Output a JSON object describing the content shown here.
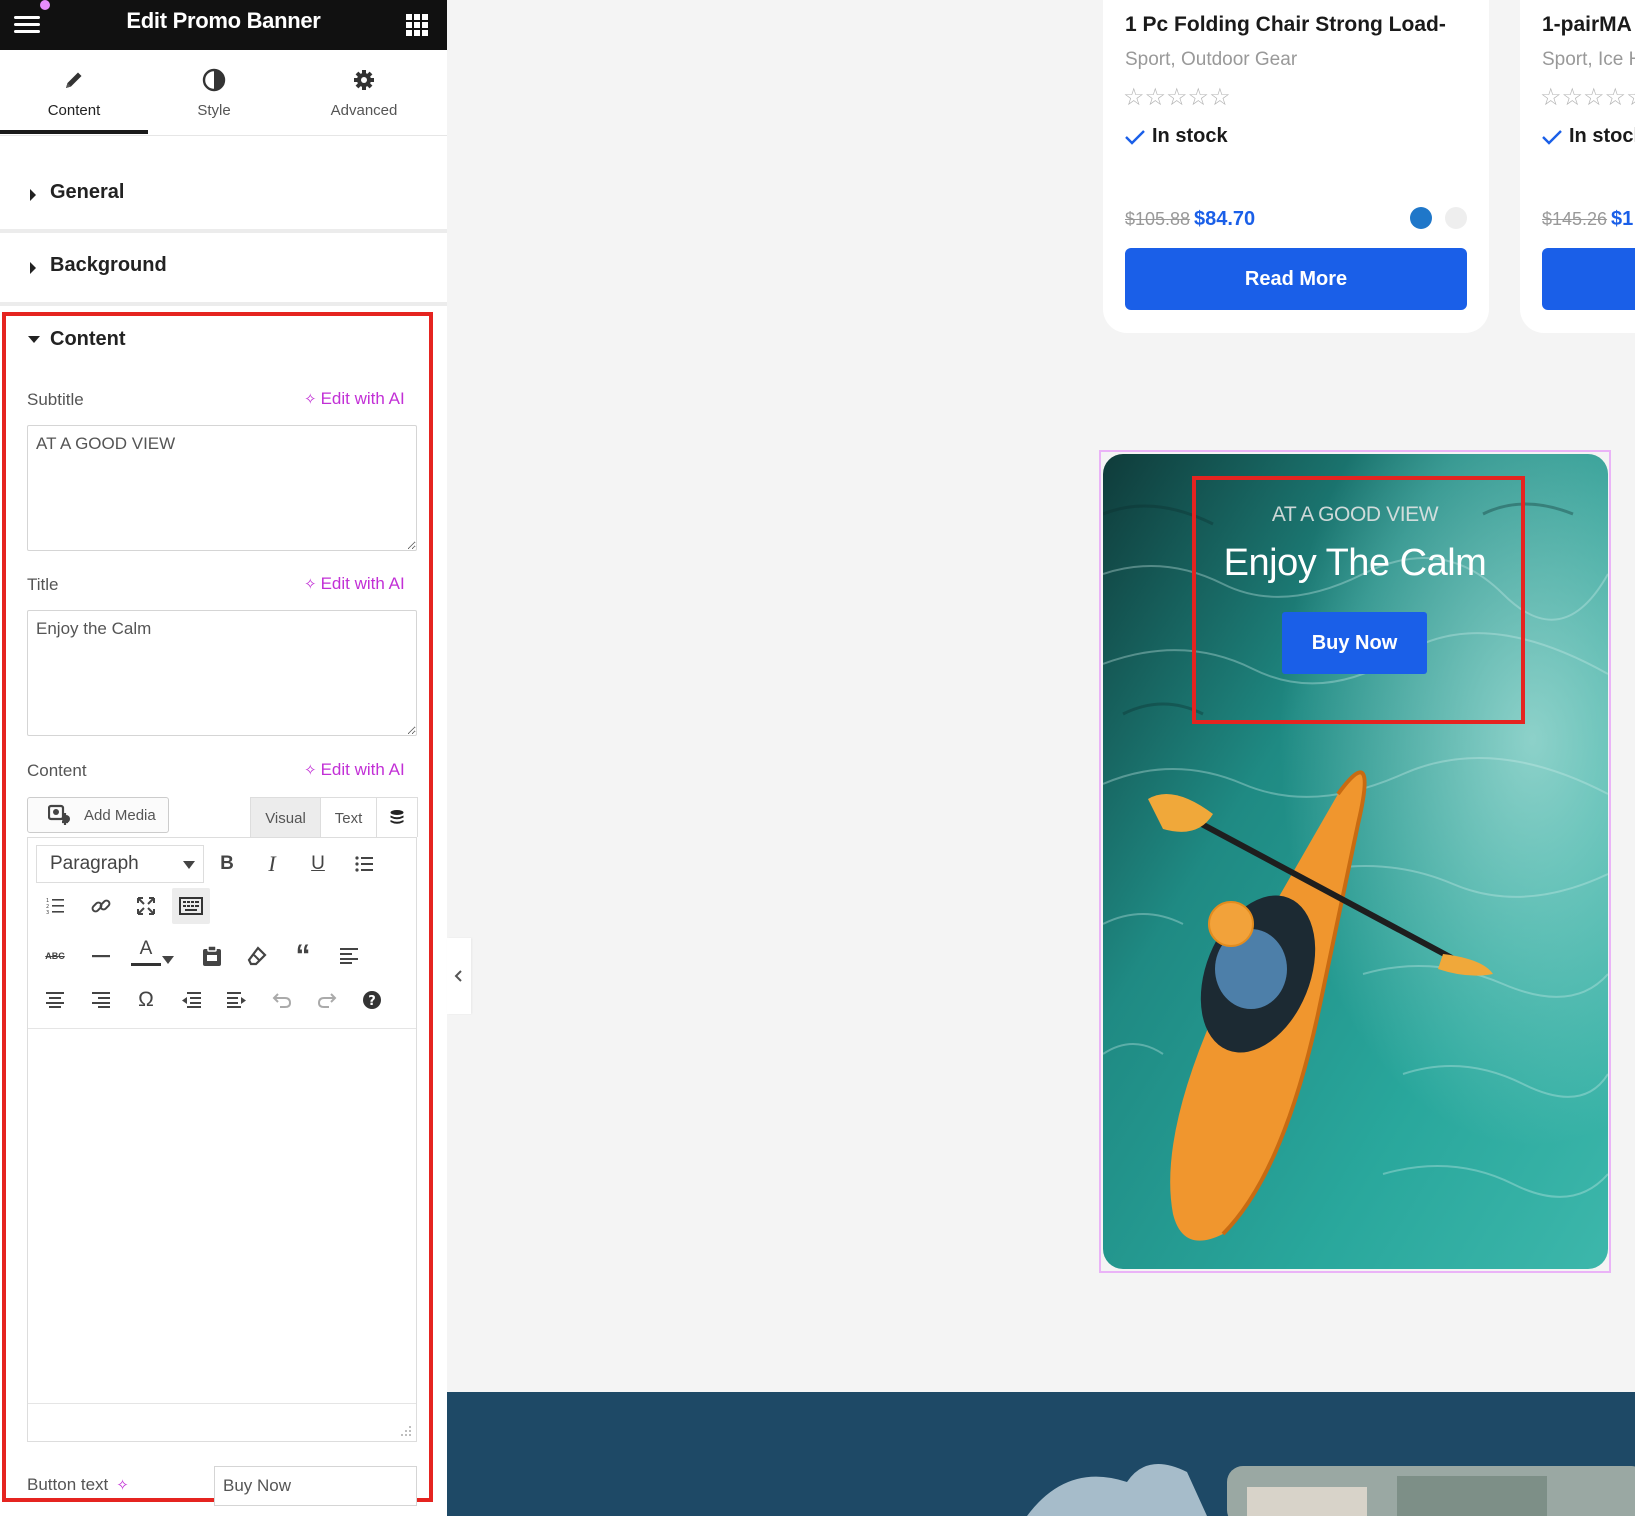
{
  "editor": {
    "header_title": "Edit Promo Banner",
    "tabs": [
      {
        "label": "Content",
        "icon": "pencil-icon",
        "active": true
      },
      {
        "label": "Style",
        "icon": "contrast-icon",
        "active": false
      },
      {
        "label": "Advanced",
        "icon": "gear-icon",
        "active": false
      }
    ],
    "sections": {
      "general": "General",
      "background": "Background",
      "content": "Content"
    },
    "fields": {
      "subtitle_label": "Subtitle",
      "subtitle_value": "AT A GOOD VIEW",
      "title_label": "Title",
      "title_value": "Enjoy the Calm",
      "content_label": "Content",
      "ai_link": "Edit with AI",
      "add_media": "Add Media",
      "mode_visual": "Visual",
      "mode_text": "Text",
      "paragraph_select": "Paragraph",
      "button_text_label": "Button text",
      "button_text_value": "Buy Now"
    },
    "accent_color": "#c230d6",
    "highlight_color": "#e52420"
  },
  "products": [
    {
      "title": "1 Pc Folding Chair Strong Load-",
      "category": "Sport, Outdoor Gear",
      "rating": 0,
      "stock": "In stock",
      "old_price": "$105.88",
      "new_price": "$84.70",
      "button": "Read More",
      "swatches": [
        "#1f77c9",
        "#eeeeee"
      ]
    },
    {
      "title": "1-pairMA",
      "category": "Sport, Ice H",
      "rating": 0,
      "stock": "In stock",
      "old_price": "$145.26",
      "new_price": "$1",
      "button": ""
    }
  ],
  "banner": {
    "subtitle": "AT A GOOD VIEW",
    "title": "Enjoy The Calm",
    "button": "Buy Now",
    "button_color": "#1a5fe8"
  },
  "colors": {
    "primary": "#1a5fe8",
    "canvas_bg": "#f4f4f4",
    "topbar_bg": "#111111"
  }
}
